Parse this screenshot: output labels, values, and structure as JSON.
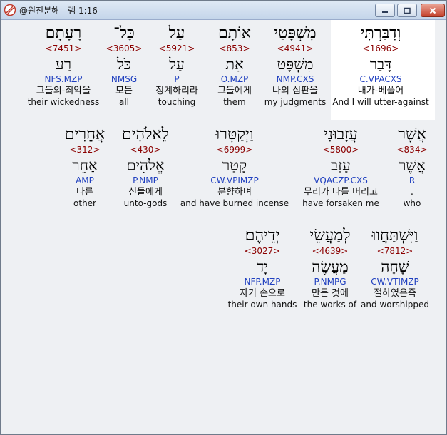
{
  "window": {
    "title": "@원전분해 - 렘 1:16",
    "buttons": {
      "minimize_icon": "minimize-icon",
      "maximize_icon": "maximize-icon",
      "close_icon": "close-icon"
    }
  },
  "colors": {
    "strong": "#8b0000",
    "parse": "#1f3fbf",
    "highlight": "#ffffff"
  },
  "rows": [
    [
      {
        "hebrew": "וְדִבַּרְתִּי",
        "strong": "<1696>",
        "lemma": "דָּבַר",
        "parse": "C.VPACXS",
        "korean": "내가-베풀어",
        "english": "And  I will utter-against"
      },
      {
        "hebrew": "מִשְׁפָּטַי",
        "strong": "<4941>",
        "lemma": "מִשְׁפָּט",
        "parse": "NMP.CXS",
        "korean": "나의 심판을",
        "english": "my judgments"
      },
      {
        "hebrew": "אוֹתָם",
        "strong": "<853>",
        "lemma": "אֵת",
        "parse": "O.MZP",
        "korean": "그들에게",
        "english": "them"
      },
      {
        "hebrew": "עַל",
        "strong": "<5921>",
        "lemma": "עַל",
        "parse": "P",
        "korean": "징계하리라",
        "english": "touching"
      },
      {
        "hebrew": "כָּל־",
        "strong": "<3605>",
        "lemma": "כֹּל",
        "parse": "NMSG",
        "korean": "모든",
        "english": "all"
      },
      {
        "hebrew": "רָעָתָם",
        "strong": "<7451>",
        "lemma": "רַע",
        "parse": "NFS.MZP",
        "korean": "그들의-죄악을",
        "english": "their wickedness"
      }
    ],
    [
      {
        "hebrew": "אֲשֶׁר",
        "strong": "<834>",
        "lemma": "אֲשֶׁר",
        "parse": "R",
        "korean": ".",
        "english": "who"
      },
      {
        "hebrew": "עֲזָבוּנִי",
        "strong": "<5800>",
        "lemma": "עָזַב",
        "parse": "VQACZP.CXS",
        "korean": "무리가 나를 버리고",
        "english": "have forsaken me"
      },
      {
        "hebrew": "וַיְקַטְּרוּ",
        "strong": "<6999>",
        "lemma": "קָטַר",
        "parse": "CW.VPIMZP",
        "korean": "분향하며",
        "english": "and have burned incense"
      },
      {
        "hebrew": "לֵאלֹהִים",
        "strong": "<430>",
        "lemma": "אֱלֹהִים",
        "parse": "P.NMP",
        "korean": "신들에게",
        "english": "unto-gods"
      },
      {
        "hebrew": "אֲחֵרִים",
        "strong": "<312>",
        "lemma": "אַחֵר",
        "parse": "AMP",
        "korean": "다른",
        "english": "other"
      }
    ],
    [
      {
        "hebrew": "וַיִּשְׁתַּחֲווּ",
        "strong": "<7812>",
        "lemma": "שָׁחָה",
        "parse": "CW.VTIMZP",
        "korean": "절하였은즉",
        "english": "and worshipped"
      },
      {
        "hebrew": "לְמַעֲשֵׂי",
        "strong": "<4639>",
        "lemma": "מַעֲשֶׂה",
        "parse": "P.NMPG",
        "korean": "만든 것에",
        "english": "the works of"
      },
      {
        "hebrew": "יְדֵיהֶם׃",
        "strong": "<3027>",
        "lemma": "יָד",
        "parse": "NFP.MZP",
        "korean": "자기 손으로",
        "english": "their own hands"
      }
    ]
  ]
}
